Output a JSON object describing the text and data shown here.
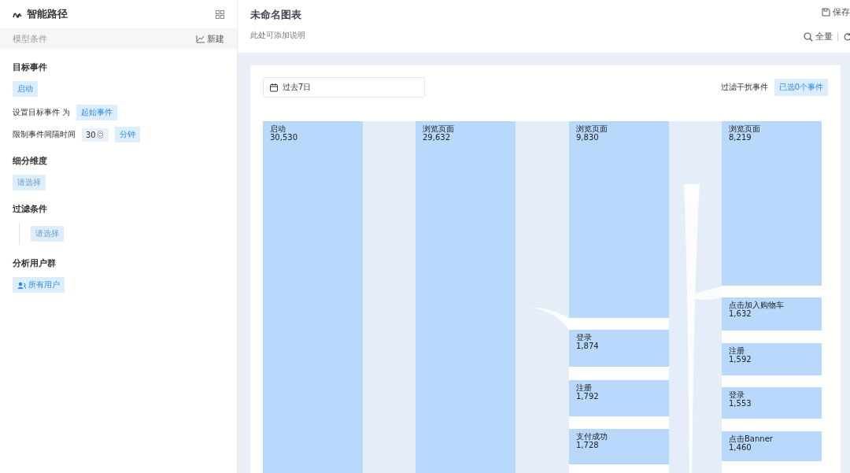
{
  "sidebar": {
    "title": "智能路径",
    "section_header": {
      "label": "模型条件",
      "new_button": "新建"
    },
    "target_event": {
      "heading": "目标事件",
      "event": "启动",
      "set_label": "设置目标事件 为",
      "set_value": "起始事件",
      "interval_label": "限制事件间隔时间",
      "interval_value": "30",
      "interval_unit": "分钟"
    },
    "breakdown": {
      "heading": "细分维度",
      "placeholder": "请选择"
    },
    "filter": {
      "heading": "过滤条件",
      "placeholder": "请选择"
    },
    "user_group": {
      "heading": "分析用户群",
      "value": "所有用户"
    }
  },
  "header": {
    "title": "未命名图表",
    "description": "此处可添加说明",
    "save": "保存",
    "scope": "全量"
  },
  "toolbar": {
    "date_range": "过去7日",
    "filter_label": "过滤干扰事件",
    "filter_value": "已选0个事件"
  },
  "sankey": {
    "columns": [
      {
        "nodes": [
          {
            "name": "启动",
            "value": "30,530"
          }
        ]
      },
      {
        "nodes": [
          {
            "name": "浏览页面",
            "value": "29,632"
          }
        ]
      },
      {
        "nodes": [
          {
            "name": "浏览页面",
            "value": "9,830"
          },
          {
            "name": "登录",
            "value": "1,874"
          },
          {
            "name": "注册",
            "value": "1,792"
          },
          {
            "name": "支付成功",
            "value": "1,728"
          }
        ]
      },
      {
        "nodes": [
          {
            "name": "浏览页面",
            "value": "8,219"
          },
          {
            "name": "点击加入购物车",
            "value": "1,632"
          },
          {
            "name": "注册",
            "value": "1,592"
          },
          {
            "name": "登录",
            "value": "1,553"
          },
          {
            "name": "点击Banner",
            "value": "1,460"
          }
        ]
      }
    ]
  }
}
